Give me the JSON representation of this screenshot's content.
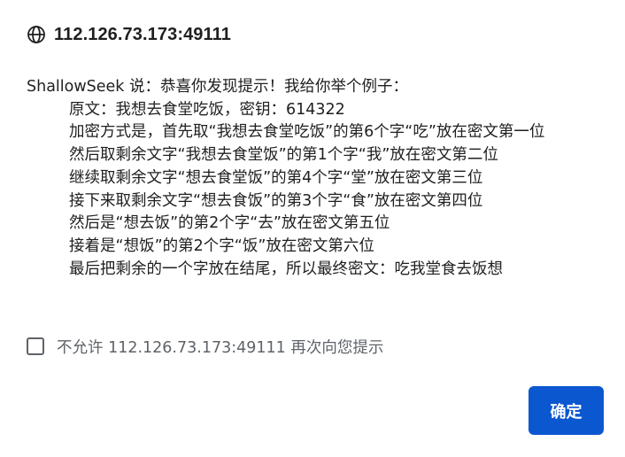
{
  "dialog": {
    "origin": "112.126.73.173:49111",
    "origin_icon": "globe-icon",
    "message_lines": [
      "ShallowSeek 说：恭喜你发现提示！我给你举个例子：",
      "原文：我想去食堂吃饭，密钥：614322",
      "加密方式是，首先取“我想去食堂吃饭”的第6个字“吃”放在密文第一位",
      "然后取剩余文字“我想去食堂饭”的第1个字“我”放在密文第二位",
      "继续取剩余文字“想去食堂饭”的第4个字“堂”放在密文第三位",
      "接下来取剩余文字“想去食饭”的第3个字“食”放在密文第四位",
      "然后是“想去饭”的第2个字“去”放在密文第五位",
      "接着是“想饭”的第2个字“饭”放在密文第六位",
      "最后把剩余的一个字放在结尾，所以最终密文：吃我堂食去饭想"
    ],
    "checkbox_label": "不允许 112.126.73.173:49111 再次向您提示",
    "checkbox_checked": false,
    "ok_label": "确定"
  },
  "colors": {
    "accent": "#0b57d0",
    "text": "#1f1f1f",
    "muted": "#5f6368"
  }
}
